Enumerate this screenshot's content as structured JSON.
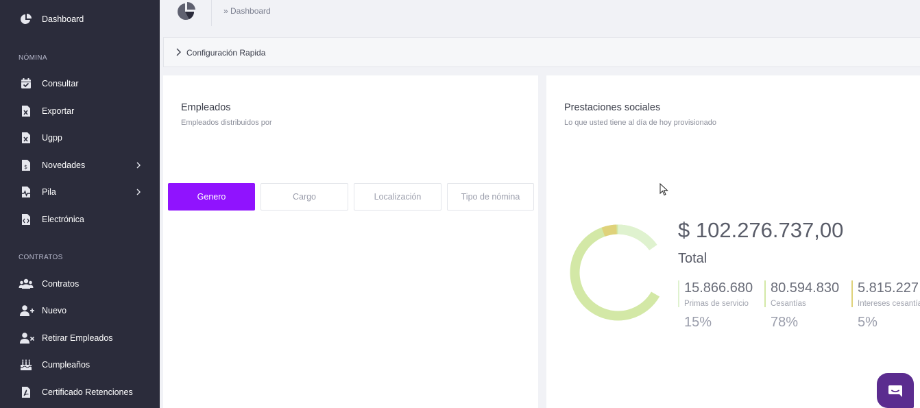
{
  "sidebar": {
    "items": [
      {
        "label": "Dashboard",
        "icon": "pie-chart-icon",
        "has_arrow": false
      },
      {
        "label": "Consultar",
        "icon": "calendar-check-icon",
        "has_arrow": false
      },
      {
        "label": "Exportar",
        "icon": "excel-file-icon",
        "has_arrow": false
      },
      {
        "label": "Ugpp",
        "icon": "excel-file-icon",
        "has_arrow": false
      },
      {
        "label": "Novedades",
        "icon": "dollar-file-icon",
        "has_arrow": true
      },
      {
        "label": "Pila",
        "icon": "pulse-file-icon",
        "has_arrow": true
      },
      {
        "label": "Electrónica",
        "icon": "code-file-icon",
        "has_arrow": false
      },
      {
        "label": "Contratos",
        "icon": "users-icon",
        "has_arrow": false
      },
      {
        "label": "Nuevo",
        "icon": "user-plus-icon",
        "has_arrow": false
      },
      {
        "label": "Retirar Empleados",
        "icon": "user-remove-icon",
        "has_arrow": false
      },
      {
        "label": "Cumpleaños",
        "icon": "birthday-cake-icon",
        "has_arrow": false
      },
      {
        "label": "Certificado Retenciones",
        "icon": "pdf-file-icon",
        "has_arrow": false
      }
    ],
    "sections": {
      "nomina": "NÓMINA",
      "contratos": "CONTRATOS"
    }
  },
  "header": {
    "breadcrumb": "» Dashboard"
  },
  "config": {
    "label": "Configuración Rapida"
  },
  "empleados": {
    "title": "Empleados",
    "subtitle": "Empleados distribuidos por",
    "tabs": [
      "Genero",
      "Cargo",
      "Localización",
      "Tipo de nómina"
    ],
    "active_tab": "Genero"
  },
  "prestaciones": {
    "title": "Prestaciones sociales",
    "subtitle": "Lo que usted tiene al día de hoy provisionado",
    "total_amount": "$ 102.276.737,00",
    "total_label": "Total",
    "stats": [
      {
        "value": "15.866.680",
        "name": "Primas de servicio",
        "pct": "15%",
        "color": "#dff2cf"
      },
      {
        "value": "80.594.830",
        "name": "Cesantías",
        "pct": "78%",
        "color": "#d3e8a6"
      },
      {
        "value": "5.815.227",
        "name": "Intereses cesantías",
        "pct": "5%",
        "color": "#dfd27a"
      }
    ]
  },
  "colors": {
    "sidebar_bg": "#2b2c3b",
    "accent": "#9013fe",
    "chat_button": "#5b2c8f"
  }
}
